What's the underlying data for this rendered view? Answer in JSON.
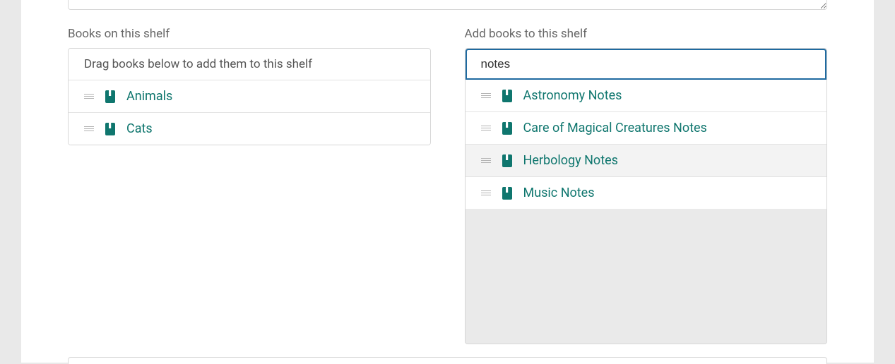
{
  "left": {
    "label": "Books on this shelf",
    "header": "Drag books below to add them to this shelf",
    "items": [
      {
        "title": "Animals"
      },
      {
        "title": "Cats"
      }
    ]
  },
  "right": {
    "label": "Add books to this shelf",
    "search_value": "notes",
    "results": [
      {
        "title": "Astronomy Notes",
        "hovered": false
      },
      {
        "title": "Care of Magical Creatures Notes",
        "hovered": false
      },
      {
        "title": "Herbology Notes",
        "hovered": true
      },
      {
        "title": "Music Notes",
        "hovered": false
      }
    ]
  },
  "colors": {
    "link": "#0f766e",
    "focus": "#1f6aa0"
  }
}
